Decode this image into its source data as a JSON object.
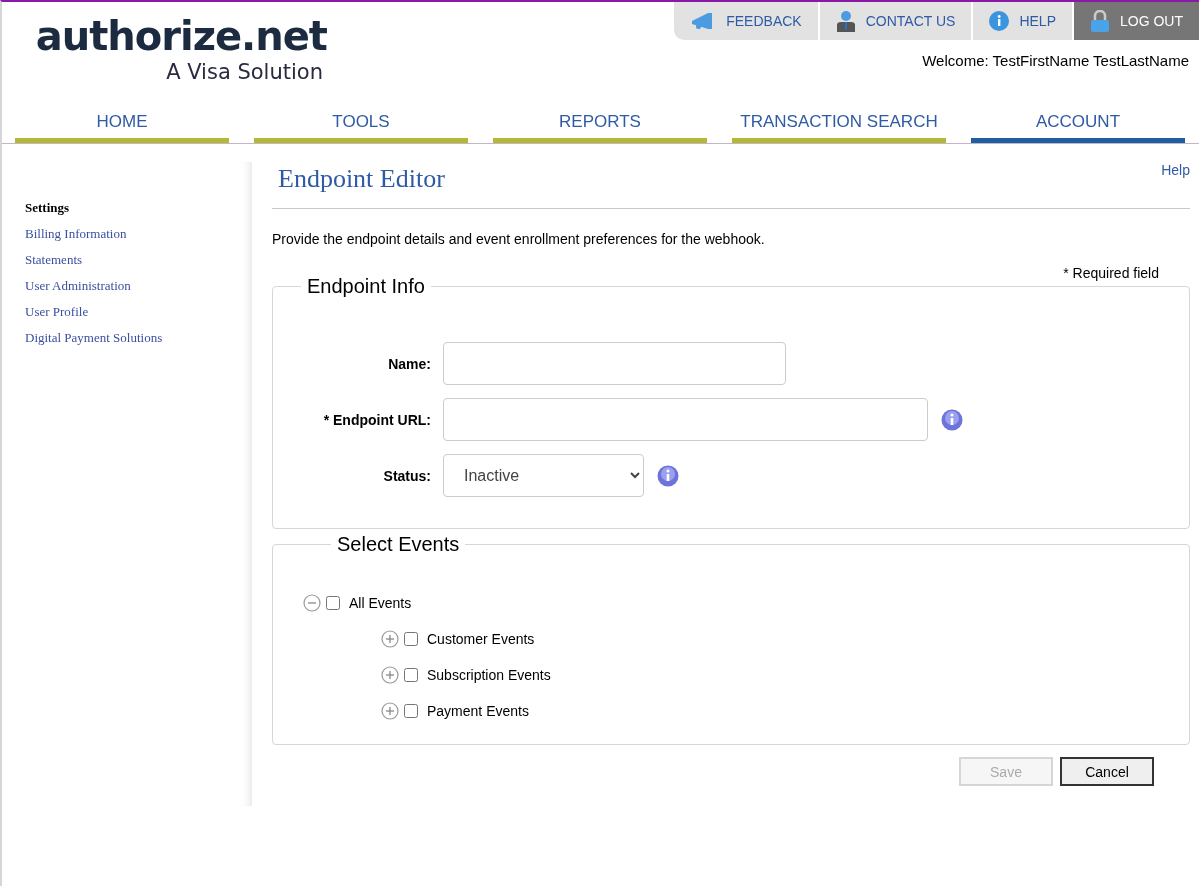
{
  "logo": {
    "name": "authorize.net",
    "tagline": "A Visa Solution"
  },
  "top_links": [
    {
      "kind": "feedback",
      "label": "FEEDBACK"
    },
    {
      "kind": "contact",
      "label": "CONTACT US"
    },
    {
      "kind": "help",
      "label": "HELP"
    },
    {
      "kind": "logout",
      "label": "LOG OUT"
    }
  ],
  "welcome": "Welcome: TestFirstName TestLastName",
  "nav_tabs": [
    {
      "label": "HOME",
      "selected": false
    },
    {
      "label": "TOOLS",
      "selected": false
    },
    {
      "label": "REPORTS",
      "selected": false
    },
    {
      "label": "TRANSACTION SEARCH",
      "selected": false
    },
    {
      "label": "ACCOUNT",
      "selected": true
    }
  ],
  "sidebar": {
    "items": [
      {
        "label": "Settings",
        "selected": true
      },
      {
        "label": "Billing Information",
        "selected": false
      },
      {
        "label": "Statements",
        "selected": false
      },
      {
        "label": "User Administration",
        "selected": false
      },
      {
        "label": "User Profile",
        "selected": false
      },
      {
        "label": "Digital Payment Solutions",
        "selected": false
      }
    ]
  },
  "page": {
    "title": "Endpoint Editor",
    "help_link": "Help",
    "description": "Provide the endpoint details and event enrollment preferences for the webhook.",
    "required_note": "* Required field"
  },
  "endpoint_info": {
    "legend": "Endpoint Info",
    "fields": [
      {
        "kind": "text",
        "label": "Name:",
        "info": false
      },
      {
        "kind": "url",
        "label": "* Endpoint URL:",
        "info": true
      },
      {
        "kind": "select",
        "label": "Status:",
        "value": "Inactive",
        "info": true
      }
    ]
  },
  "select_events": {
    "legend": "Select Events",
    "tree": [
      {
        "label": "All Events",
        "checked": false,
        "expanded": true,
        "children": [
          {
            "label": "Customer Events",
            "checked": false,
            "expanded": false
          },
          {
            "label": "Subscription Events",
            "checked": false,
            "expanded": false
          },
          {
            "label": "Payment Events",
            "checked": false,
            "expanded": false
          }
        ]
      }
    ]
  },
  "buttons": [
    {
      "label": "Save",
      "disabled": true
    },
    {
      "label": "Cancel",
      "disabled": false
    }
  ]
}
